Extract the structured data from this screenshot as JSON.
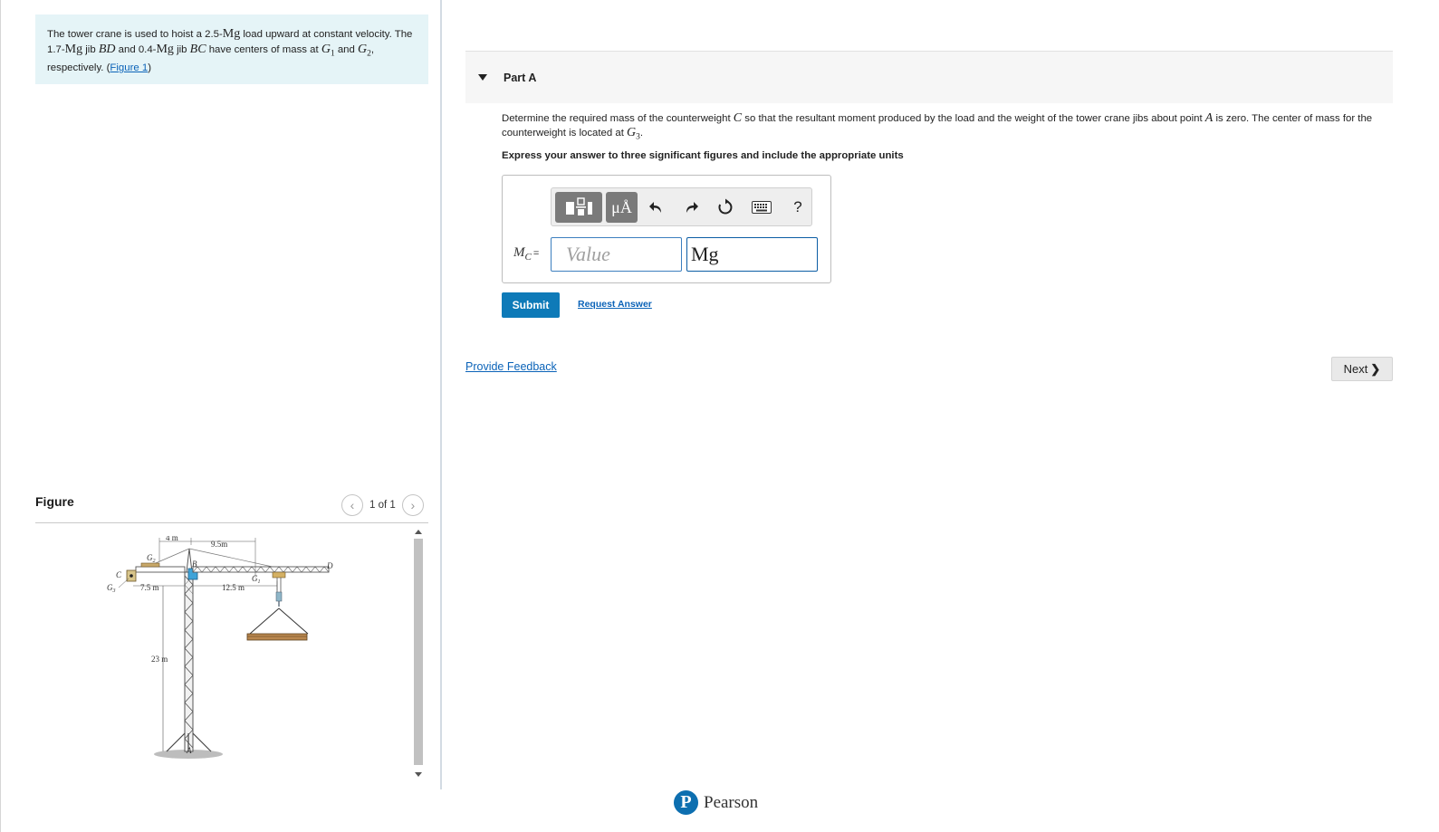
{
  "problem": {
    "t1": "The tower crane is used to hoist a 2.5-",
    "mg1": "Mg",
    "t2": " load upward at constant velocity. The 1.7-",
    "mg2": "Mg",
    "t3": " jib ",
    "bd": "BD",
    "t4": " and 0.4-",
    "mg3": "Mg",
    "t5": " jib ",
    "bc": "BC",
    "t6": " have centers of mass at ",
    "g1": "G",
    "g1sub": "1",
    "t7": " and ",
    "g2": "G",
    "g2sub": "2",
    "t8": ", respectively. (",
    "figure_link": "Figure 1",
    "t9": ")"
  },
  "figure": {
    "label": "Figure",
    "pager": "1 of 1",
    "prev_icon": "chevron-left-icon",
    "next_icon": "chevron-right-icon",
    "labels": {
      "dim_4m": "4 m",
      "dim_9_5m": "9.5m",
      "dim_7_5m": "7.5 m",
      "dim_12_5m": "12.5 m",
      "dim_23m": "23 m",
      "C": "C",
      "B": "B",
      "D": "D",
      "A": "A",
      "G1": "G",
      "G1sub": "1",
      "G2": "G",
      "G2sub": "2",
      "G3": "G",
      "G3sub": "3"
    }
  },
  "part": {
    "title": "Part A",
    "q1": "Determine the required mass of the counterweight ",
    "c": "C",
    "q2": " so that the resultant moment produced by the load and the weight of the tower crane jibs about point ",
    "a": "A",
    "q3": " is zero. The center of mass for the counterweight is located at ",
    "g3": "G",
    "g3sub": "3",
    "q4": ".",
    "instruction": "Express your answer to three significant figures and include the appropriate units",
    "toolbar": {
      "units_label": "μÅ",
      "help_label": "?",
      "undo_icon": "undo-icon",
      "redo_icon": "redo-icon",
      "reset_icon": "reset-icon",
      "keyboard_icon": "keyboard-icon",
      "templates_icon": "templates-icon"
    },
    "answer_label_m": "M",
    "answer_label_sub": "C",
    "answer_eq": "=",
    "value_placeholder": "Value",
    "units_value": "Mg",
    "submit_label": "Submit",
    "request_label": "Request Answer"
  },
  "footer": {
    "feedback_label": "Provide Feedback",
    "next_label": "Next",
    "brand": "Pearson",
    "brand_letter": "P"
  },
  "colors": {
    "accent": "#0e7ab8",
    "link": "#0b63b8",
    "problem_bg": "#e5f4f7"
  }
}
